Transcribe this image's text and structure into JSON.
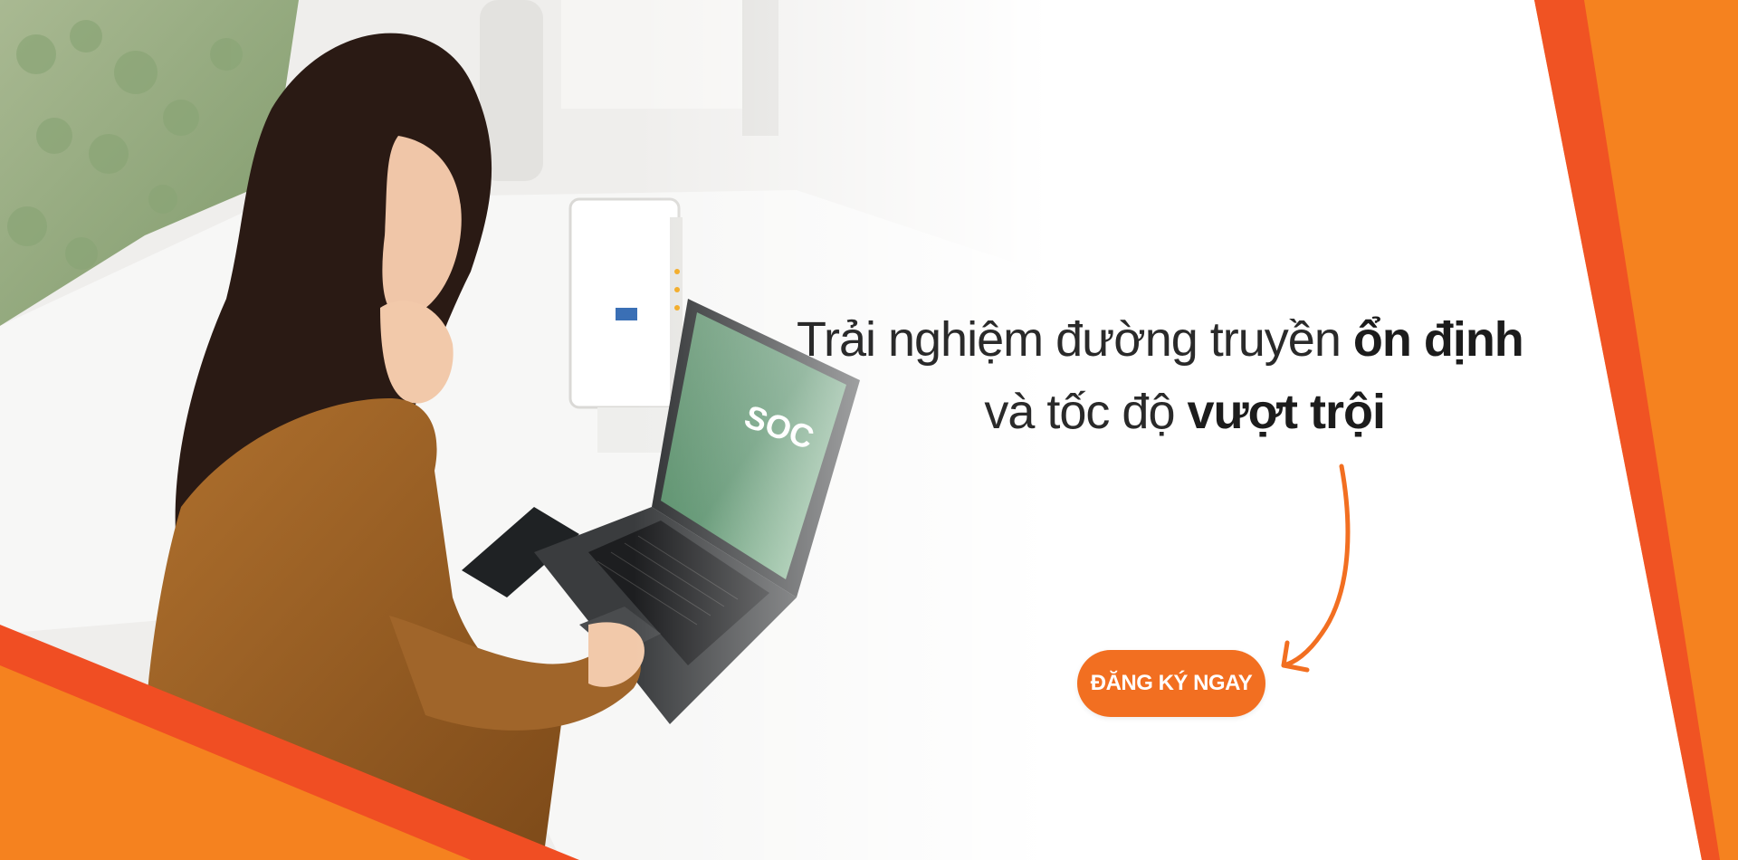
{
  "hero": {
    "headline_line1_regular": "Trải nghiệm đường truyền ",
    "headline_line1_bold": "ổn định",
    "headline_line2_regular": "và tốc độ ",
    "headline_line2_bold": "vượt trội",
    "cta_label": "ĐĂNG KÝ NGAY"
  },
  "colors": {
    "brand_orange": "#f26f21",
    "accent_orange": "#f5821f",
    "text_dark": "#2a2a2a"
  },
  "icons": {
    "arrow": "curved-arrow-icon"
  }
}
